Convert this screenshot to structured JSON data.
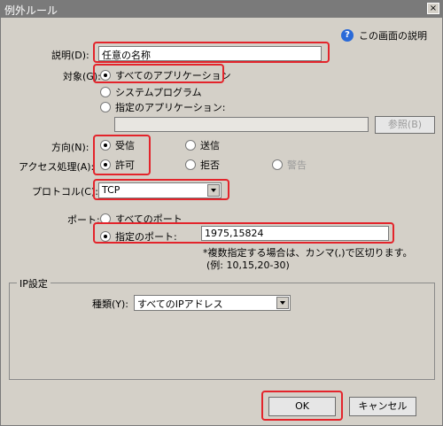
{
  "window": {
    "title": "例外ルール",
    "close_label": "×"
  },
  "help": {
    "icon": "?",
    "label": "この画面の説明"
  },
  "description": {
    "label": "説明(D):",
    "value": "任意の名称"
  },
  "target": {
    "label": "対象(G):",
    "options": [
      "すべてのアプリケーション",
      "システムプログラム",
      "指定のアプリケーション:"
    ],
    "selected": 0,
    "app_path": "",
    "browse_label": "参照(B)"
  },
  "direction": {
    "label": "方向(N):",
    "options": [
      "受信",
      "送信"
    ],
    "selected": 0
  },
  "access": {
    "label": "アクセス処理(A):",
    "options": [
      "許可",
      "拒否",
      "警告"
    ],
    "selected": 0
  },
  "protocol": {
    "label": "プロトコル(C):",
    "value": "TCP"
  },
  "port": {
    "label": "ポート:",
    "options": [
      "すべてのポート",
      "指定のポート:"
    ],
    "selected": 1,
    "value": "1975,15824",
    "note1": "*複数指定する場合は、カンマ(,)で区切ります。",
    "note2": "(例: 10,15,20-30)"
  },
  "ip": {
    "group_label": "IP設定",
    "type_label": "種類(Y):",
    "value": "すべてのIPアドレス"
  },
  "buttons": {
    "ok": "OK",
    "cancel": "キャンセル"
  },
  "colors": {
    "highlight": "#e3242b",
    "dialog_bg": "#d4d0c8",
    "titlebar": "#7a7a7a"
  }
}
